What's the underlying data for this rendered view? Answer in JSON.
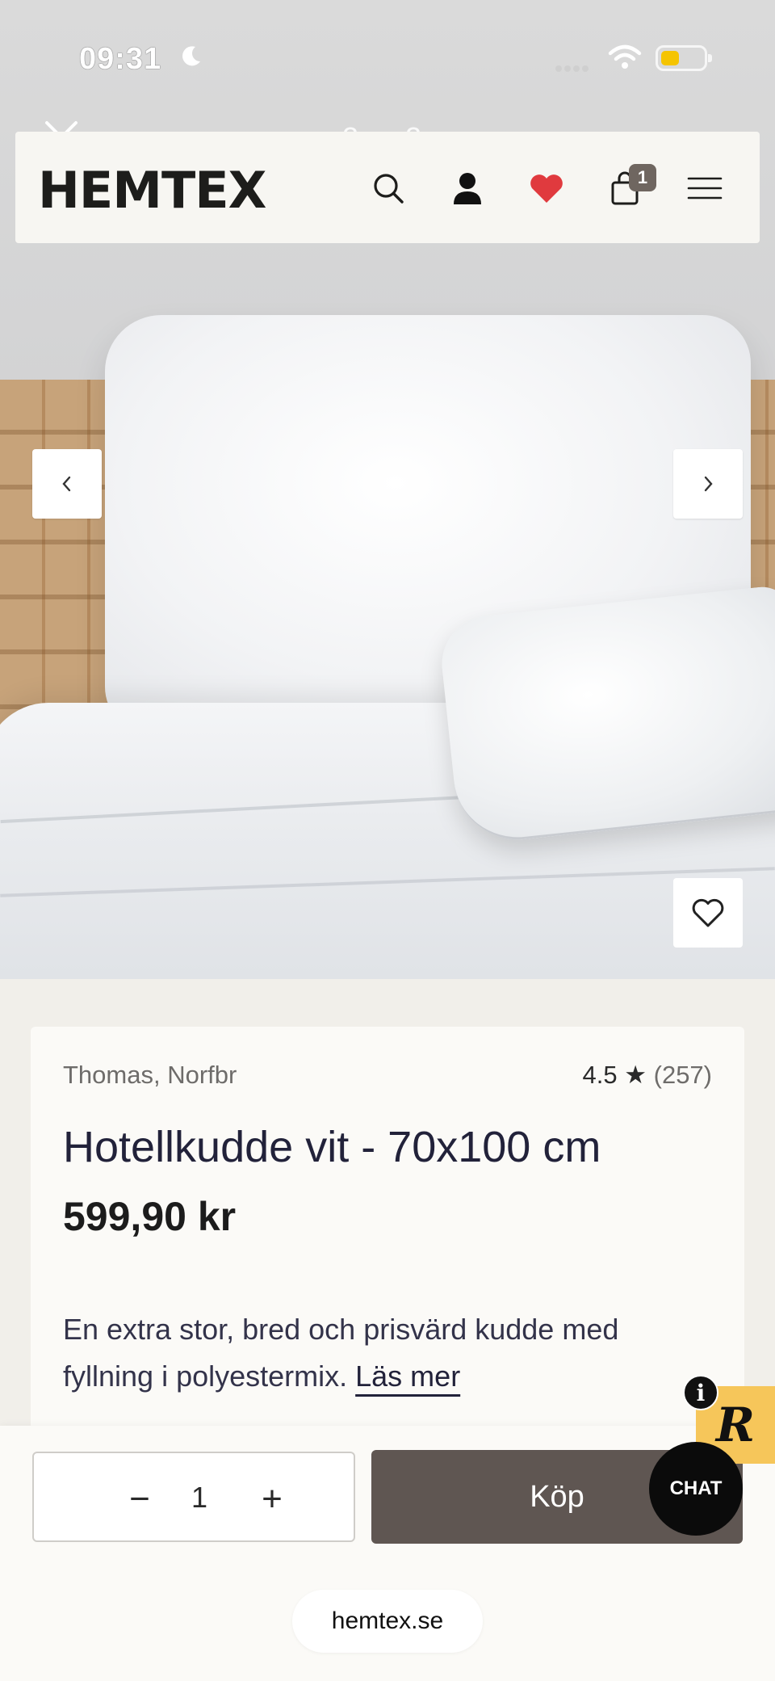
{
  "status_bar": {
    "time": "09:31",
    "icons": [
      "moon-icon",
      "signal-icon",
      "wifi-icon",
      "battery-icon"
    ],
    "battery_color": "#f5c400"
  },
  "gallery": {
    "counter": "2 av 2",
    "close_icon": "close-icon",
    "prev_icon": "chevron-left-icon",
    "next_icon": "chevron-right-icon",
    "favorite_icon": "heart-outline-icon"
  },
  "header": {
    "logo": "HEMTEX",
    "icons": [
      "search-icon",
      "account-icon",
      "heart-icon",
      "bag-icon",
      "menu-icon"
    ],
    "cart_count": "1",
    "wishlist_color": "#e03a3e"
  },
  "product": {
    "brand": "Thomas, Norfbr",
    "rating": "4.5",
    "rating_star": "★",
    "review_count": "(257)",
    "title": "Hotellkudde vit - 70x100 cm",
    "price": "599,90 kr",
    "description": "En extra stor, bred och prisvärd kudde med fyllning i polyestermix.",
    "read_more": "Läs mer"
  },
  "buy_bar": {
    "qty_minus": "−",
    "quantity": "1",
    "qty_plus": "+",
    "buy_label": "Köp",
    "buy_color": "#5f5652"
  },
  "widgets": {
    "chat_label": "CHAT",
    "review_badge": "R",
    "info_label": "i"
  },
  "browser": {
    "url": "hemtex.se"
  }
}
